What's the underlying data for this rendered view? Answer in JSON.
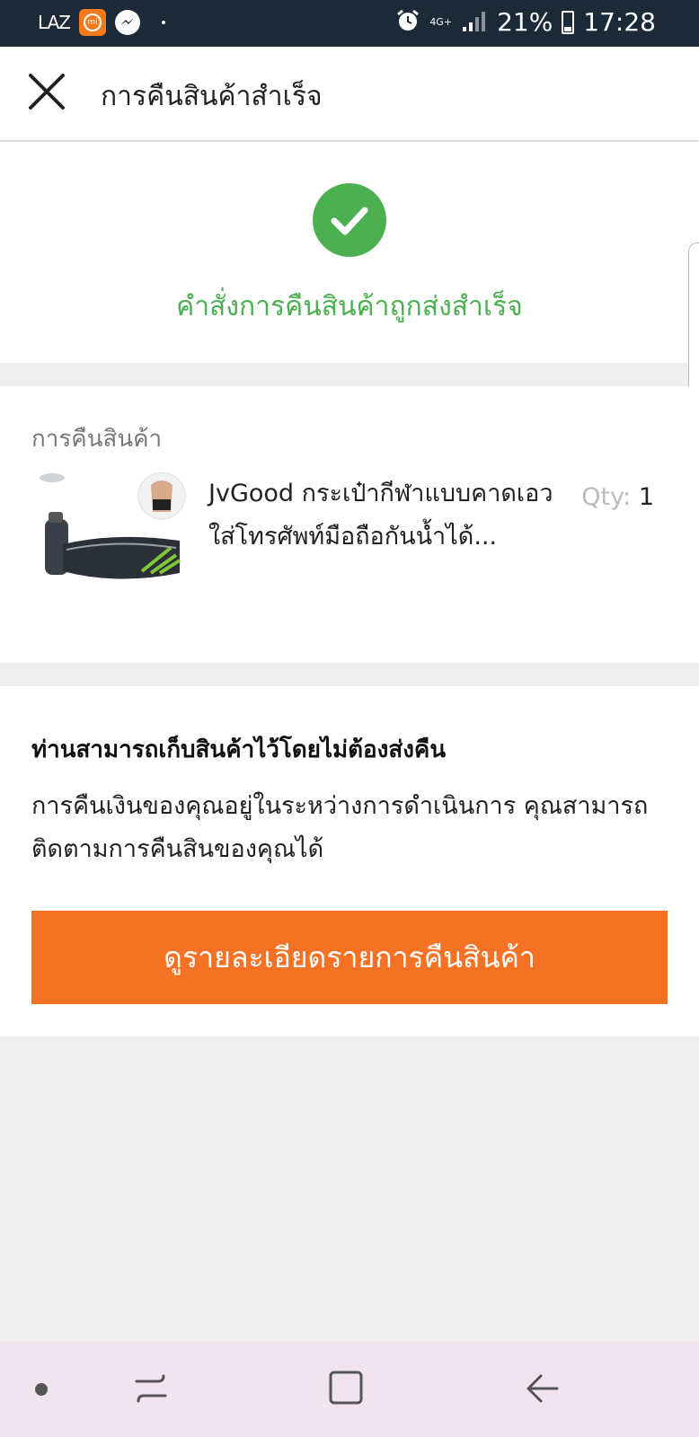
{
  "status_bar": {
    "app_label": "LAZ",
    "network": "4G+",
    "battery": "21%",
    "time": "17:28"
  },
  "header": {
    "title": "การคืนสินค้าสำเร็จ"
  },
  "success": {
    "message": "คำสั่งการคืนสินค้าถูกส่งสำเร็จ"
  },
  "return_section": {
    "label": "การคืนสินค้า",
    "item": {
      "name": "JvGood กระเป๋ากีฬาแบบคาดเอวใส่โทรศัพท์มือถือกันน้ำได้...",
      "qty_label": "Qty:",
      "qty_value": "1",
      "image_icon": "waist-bag-product-image"
    }
  },
  "info": {
    "title": "ท่านสามารถเก็บสินค้าไว้โดยไม่ต้องส่งคืน",
    "description": "การคืนเงินของคุณอยู่ในระหว่างการดำเนินการ คุณสามารถติดตามการคืนสินของคุณได้",
    "button_label": "ดูรายละเอียดรายการคืนสินค้า"
  },
  "colors": {
    "success_green": "#4caf50",
    "cta_orange": "#f57224",
    "status_bar": "#1b2a36",
    "nav_bar": "#f1e4ef"
  }
}
